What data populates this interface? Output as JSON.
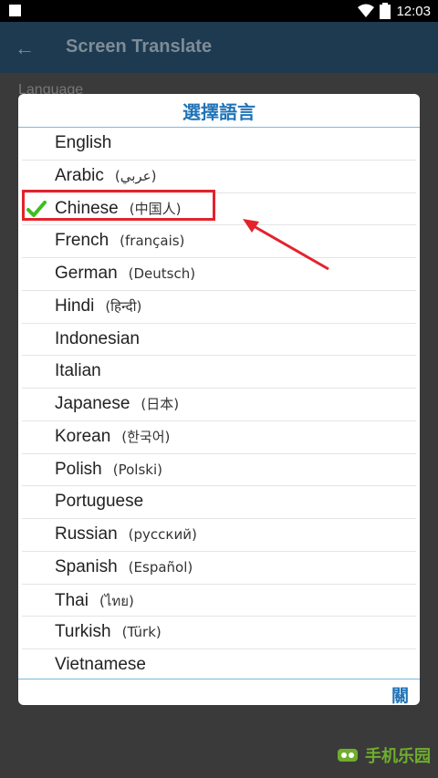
{
  "status_bar": {
    "time": "12:03"
  },
  "app_bar": {
    "title": "Screen Translate",
    "back_icon": "arrow-left-icon"
  },
  "background": {
    "language_label": "Language"
  },
  "dialog": {
    "title": "選擇語言",
    "close_label": "關",
    "selected": "Chinese",
    "languages": [
      {
        "name": "English",
        "native": ""
      },
      {
        "name": "Arabic",
        "native": "(عربي)"
      },
      {
        "name": "Chinese",
        "native": "(中国人)"
      },
      {
        "name": "French",
        "native": "(français)"
      },
      {
        "name": "German",
        "native": "(Deutsch)"
      },
      {
        "name": "Hindi",
        "native": "(हिन्दी)"
      },
      {
        "name": "Indonesian",
        "native": ""
      },
      {
        "name": "Italian",
        "native": ""
      },
      {
        "name": "Japanese",
        "native": "(日本)"
      },
      {
        "name": "Korean",
        "native": "(한국어)"
      },
      {
        "name": "Polish",
        "native": "(Polski)"
      },
      {
        "name": "Portuguese",
        "native": ""
      },
      {
        "name": "Russian",
        "native": "(русский)"
      },
      {
        "name": "Spanish",
        "native": "(Español)"
      },
      {
        "name": "Thai",
        "native": "(ไทย)"
      },
      {
        "name": "Turkish",
        "native": "(Türk)"
      },
      {
        "name": "Vietnamese",
        "native": ""
      }
    ]
  },
  "watermark": {
    "text": "手机乐园"
  },
  "colors": {
    "accent": "#1f73b7",
    "highlight": "#e3232c",
    "check": "#3bbf1f"
  }
}
